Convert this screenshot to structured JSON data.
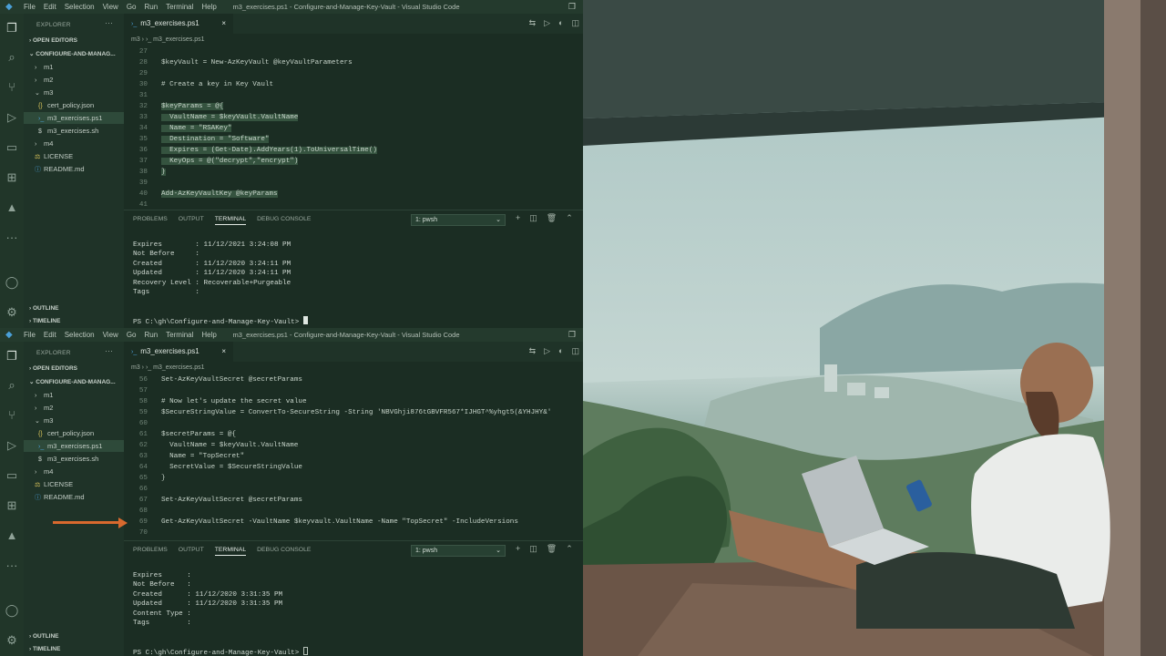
{
  "menu": [
    "File",
    "Edit",
    "Selection",
    "View",
    "Go",
    "Run",
    "Terminal",
    "Help"
  ],
  "window_title": "m3_exercises.ps1 - Configure-and-Manage-Key-Vault - Visual Studio Code",
  "sidebar": {
    "title": "EXPLORER",
    "more": "···",
    "open_editors": "OPEN EDITORS",
    "root": "CONFIGURE-AND-MANAG...",
    "outline": "OUTLINE",
    "timeline": "TIMELINE",
    "items": [
      {
        "label": "m1",
        "icon": "›"
      },
      {
        "label": "m2",
        "icon": "›"
      },
      {
        "label": "m3",
        "icon": "⌄"
      },
      {
        "label": "cert_policy.json",
        "icon": "{}"
      },
      {
        "label": "m3_exercises.ps1",
        "icon": "›_"
      },
      {
        "label": "m3_exercises.sh",
        "icon": "$"
      },
      {
        "label": "m4",
        "icon": "›"
      },
      {
        "label": "LICENSE",
        "icon": "⚖"
      },
      {
        "label": "README.md",
        "icon": "ⓘ"
      }
    ]
  },
  "tab": {
    "label": "m3_exercises.ps1",
    "icon": "›_",
    "close": "×"
  },
  "breadcrumb": "m3 › ›_ m3_exercises.ps1",
  "panel_tabs": [
    "PROBLEMS",
    "OUTPUT",
    "TERMINAL",
    "DEBUG CONSOLE"
  ],
  "terminal_select": "1: pwsh",
  "editor1": {
    "lines": [
      {
        "n": "27",
        "t": ""
      },
      {
        "n": "28",
        "t": "$keyVault = New-AzKeyVault @keyVaultParameters"
      },
      {
        "n": "29",
        "t": ""
      },
      {
        "n": "30",
        "t": "# Create a key in Key Vault"
      },
      {
        "n": "31",
        "t": ""
      },
      {
        "n": "32",
        "t": "$keyParams = @{",
        "hl": true
      },
      {
        "n": "33",
        "t": "  VaultName = $keyVault.VaultName",
        "hl": true
      },
      {
        "n": "34",
        "t": "  Name = \"RSAKey\"",
        "hl": true
      },
      {
        "n": "35",
        "t": "  Destination = \"Software\"",
        "hl": true
      },
      {
        "n": "36",
        "t": "  Expires = (Get-Date).AddYears(1).ToUniversalTime()",
        "hl": true
      },
      {
        "n": "37",
        "t": "  KeyOps = @(\"decrypt\",\"encrypt\")",
        "hl": true
      },
      {
        "n": "38",
        "t": "}",
        "hl": true
      },
      {
        "n": "39",
        "t": ""
      },
      {
        "n": "40",
        "t": "Add-AzKeyVaultKey @keyParams",
        "hl": true
      },
      {
        "n": "41",
        "t": ""
      }
    ]
  },
  "terminal1": {
    "lines": [
      "Expires        : 11/12/2021 3:24:08 PM",
      "Not Before     :",
      "Created        : 11/12/2020 3:24:11 PM",
      "Updated        : 11/12/2020 3:24:11 PM",
      "Recovery Level : Recoverable+Purgeable",
      "Tags           :",
      "",
      ""
    ],
    "prompt": "PS C:\\gh\\Configure-and-Manage-Key-Vault> "
  },
  "editor2": {
    "lines": [
      {
        "n": "56",
        "t": "Set-AzKeyVaultSecret @secretParams"
      },
      {
        "n": "57",
        "t": ""
      },
      {
        "n": "58",
        "t": "# Now let's update the secret value"
      },
      {
        "n": "59",
        "t": "$SecureStringValue = ConvertTo-SecureString -String 'NBVGhji876tGBVFR567*IJHGT^%yhgt5(&YHJHY&'"
      },
      {
        "n": "60",
        "t": ""
      },
      {
        "n": "61",
        "t": "$secretParams = @{"
      },
      {
        "n": "62",
        "t": "  VaultName = $keyVault.VaultName"
      },
      {
        "n": "63",
        "t": "  Name = \"TopSecret\""
      },
      {
        "n": "64",
        "t": "  SecretValue = $SecureStringValue"
      },
      {
        "n": "65",
        "t": "}"
      },
      {
        "n": "66",
        "t": ""
      },
      {
        "n": "67",
        "t": "Set-AzKeyVaultSecret @secretParams"
      },
      {
        "n": "68",
        "t": ""
      },
      {
        "n": "69",
        "t": "Get-AzKeyVaultSecret -VaultName $keyvault.VaultName -Name \"TopSecret\" -IncludeVersions"
      },
      {
        "n": "70",
        "t": ""
      }
    ]
  },
  "terminal2": {
    "lines": [
      "Expires      :",
      "Not Before   :",
      "Created      : 11/12/2020 3:31:35 PM",
      "Updated      : 11/12/2020 3:31:35 PM",
      "Content Type :",
      "Tags         :",
      "",
      ""
    ],
    "prompt": "PS C:\\gh\\Configure-and-Manage-Key-Vault> "
  },
  "colors": {
    "accent": "#4a9fd8",
    "arrow": "#d8692e",
    "bg": "#1e3227"
  }
}
